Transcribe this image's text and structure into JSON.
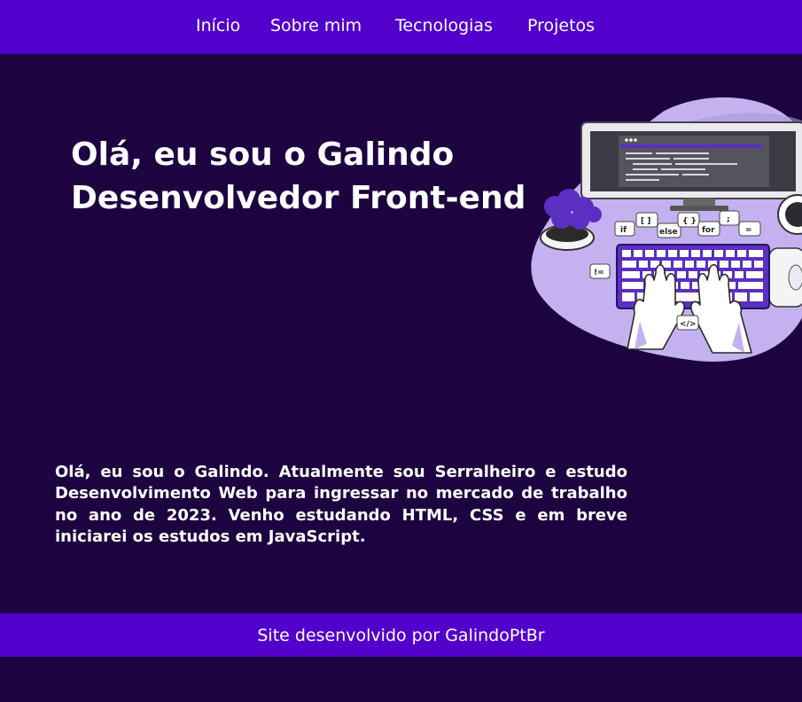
{
  "nav": {
    "items": [
      {
        "label": "Início"
      },
      {
        "label": "Sobre mim"
      },
      {
        "label": "Tecnologias"
      },
      {
        "label": "Projetos"
      }
    ]
  },
  "hero": {
    "line1": "Olá, eu sou o Galindo",
    "line2": "Desenvolvedor Front-end",
    "illustration": {
      "icon": "programmer-laptop-illustration",
      "code_tags": [
        "if",
        "[ ]",
        "else",
        "{ }",
        "for",
        ";",
        "=",
        "!=",
        "</>"
      ]
    }
  },
  "about": {
    "text": "Olá, eu sou o Galindo. Atualmente sou Serralheiro e estudo Desenvolvimento Web para ingressar no mercado de trabalho no ano de 2023. Venho estudando HTML, CSS e em breve iniciarei os estudos em JavaScript."
  },
  "footer": {
    "text": "Site desenvolvido por GalindoPtBr"
  },
  "colors": {
    "background": "#1d0340",
    "header": "#5200cc",
    "footer": "#5200cc",
    "blob": "#c4b2f0",
    "accent": "#5a2fc2"
  }
}
